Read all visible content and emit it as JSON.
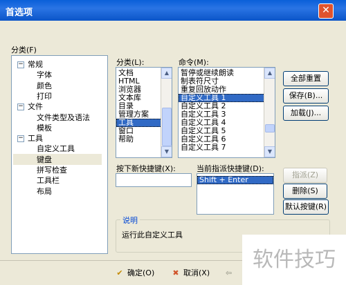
{
  "window": {
    "title": "首选项",
    "close_glyph": "✕"
  },
  "category_label": "分类(F)",
  "tree": [
    {
      "label": "常规",
      "expander": "−",
      "level": 0
    },
    {
      "label": "字体",
      "level": 1
    },
    {
      "label": "颜色",
      "level": 1
    },
    {
      "label": "打印",
      "level": 1
    },
    {
      "label": "文件",
      "expander": "−",
      "level": 0
    },
    {
      "label": "文件类型及语法",
      "level": 1
    },
    {
      "label": "模板",
      "level": 1
    },
    {
      "label": "工具",
      "expander": "−",
      "level": 0
    },
    {
      "label": "自定义工具",
      "level": 1
    },
    {
      "label": "键盘",
      "level": 1,
      "selected": true
    },
    {
      "label": "拼写检查",
      "level": 1
    },
    {
      "label": "工具栏",
      "level": 1
    },
    {
      "label": "布局",
      "level": 1
    }
  ],
  "sub_category": {
    "label": "分类(L):",
    "items": [
      "文档",
      "HTML",
      "浏览器",
      "文本库",
      "目录",
      "管理方案",
      "工具",
      "窗口",
      "帮助"
    ],
    "selected_index": 6
  },
  "commands": {
    "label": "命令(M):",
    "items": [
      "暂停或继续朗读",
      "制表符尺寸",
      "重复回放动作",
      "自定义工具 1",
      "自定义工具 2",
      "自定义工具 3",
      "自定义工具 4",
      "自定义工具 5",
      "自定义工具 6",
      "自定义工具 7"
    ],
    "selected_index": 3
  },
  "buttons": {
    "reset_all": "全部重置",
    "save": "保存(B)...",
    "load": "加载(J)...",
    "assign": "指派(Z)",
    "delete": "删除(S)",
    "default_keys": "默认按键(R)"
  },
  "new_shortcut": {
    "label": "按下新快捷键(X):",
    "value": ""
  },
  "current_shortcut": {
    "label": "当前指派快捷键(D):",
    "items": [
      "Shift + Enter"
    ]
  },
  "description": {
    "legend": "说明",
    "text": "运行此自定义工具"
  },
  "footer": {
    "ok": "确定(O)",
    "cancel": "取消(X)"
  },
  "watermark": "软件技巧"
}
